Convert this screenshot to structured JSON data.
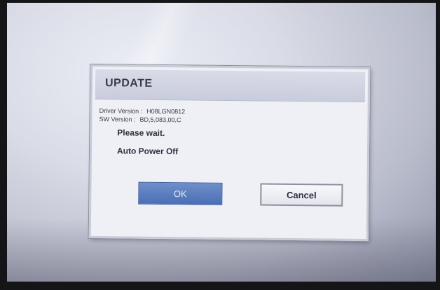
{
  "dialog": {
    "title": "UPDATE",
    "driver_version_label": "Driver Version :",
    "driver_version_value": "H08LGN0812",
    "sw_version_label": "SW Version :",
    "sw_version_value": "BD,5,083,00,C",
    "message_wait": "Please wait.",
    "message_power": "Auto Power Off",
    "ok_label": "OK",
    "cancel_label": "Cancel"
  },
  "colors": {
    "ok_button": "#4a6fb6",
    "dialog_background": "#eef0f6",
    "header_background": "#c9ccdc"
  }
}
